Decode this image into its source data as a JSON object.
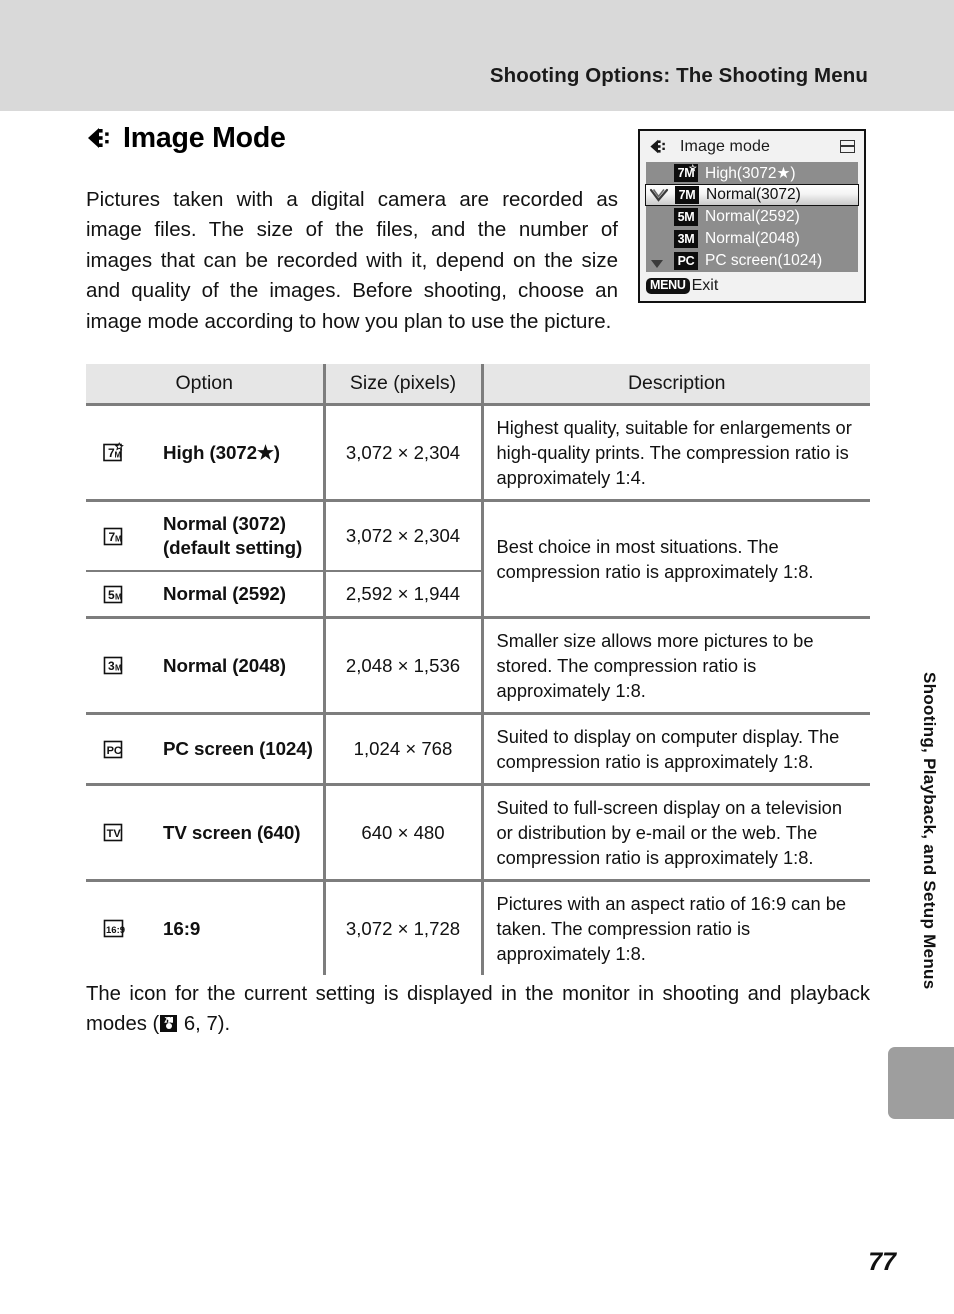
{
  "header": {
    "running_title": "Shooting Options: The Shooting Menu"
  },
  "section": {
    "icon": "image-mode-icon",
    "title": "Image Mode",
    "intro": "Pictures taken with a digital camera are recorded as image files. The size of the files, and the number of images that can be recorded with it, depend on the size and quality of the images. Before shooting, choose an image mode according to how you plan to use the picture."
  },
  "camera_screen": {
    "title": "Image mode",
    "title_icon": "image-mode-icon",
    "card_icon": "memory-card-icon",
    "items": [
      {
        "badge": "7",
        "badge_unit": "M",
        "badge_star": "☆",
        "label": "High(3072★)",
        "selected": false,
        "checked": false
      },
      {
        "badge": "7",
        "badge_unit": "M",
        "badge_star": "",
        "label": "Normal(3072)",
        "selected": true,
        "checked": true
      },
      {
        "badge": "5",
        "badge_unit": "M",
        "badge_star": "",
        "label": "Normal(2592)",
        "selected": false,
        "checked": false
      },
      {
        "badge": "3",
        "badge_unit": "M",
        "badge_star": "",
        "label": "Normal(2048)",
        "selected": false,
        "checked": false
      },
      {
        "badge": "PC",
        "badge_unit": "",
        "badge_star": "",
        "label": "PC screen(1024)",
        "selected": false,
        "checked": false
      }
    ],
    "menu_badge": "MENU",
    "exit_label": "Exit"
  },
  "table": {
    "headers": [
      "Option",
      "Size (pixels)",
      "Description"
    ],
    "rows": [
      {
        "icon": "7m-star-icon",
        "option": "High (3072★)",
        "size": "3,072 × 2,304",
        "description": "Highest quality, suitable for enlargements or high-quality prints. The compression ratio is approximately 1:4."
      },
      {
        "icon": "7m-icon",
        "option": "Normal (3072)\n(default setting)",
        "size": "3,072 × 2,304",
        "description": "Best choice in most situations. The compression ratio is approximately 1:8."
      },
      {
        "icon": "5m-icon",
        "option": "Normal (2592)",
        "size": "2,592 × 1,944",
        "description": ""
      },
      {
        "icon": "3m-icon",
        "option": "Normal (2048)",
        "size": "2,048 × 1,536",
        "description": "Smaller size allows more pictures to be stored. The compression ratio is approximately 1:8."
      },
      {
        "icon": "pc-icon",
        "option": "PC screen (1024)",
        "size": "1,024 × 768",
        "description": "Suited to display on computer display. The compression ratio is approximately 1:8."
      },
      {
        "icon": "tv-icon",
        "option": "TV screen (640)",
        "size": "640 × 480",
        "description": "Suited to full-screen display on a television or distribution by e-mail or the web. The compression ratio is approximately 1:8."
      },
      {
        "icon": "16-9-icon",
        "option": "16:9",
        "size": "3,072 × 1,728",
        "description": "Pictures with an aspect ratio of 16:9 can be taken. The compression ratio is approximately 1:8."
      }
    ]
  },
  "closing": {
    "text_before": "The icon for the current setting is displayed in the monitor in shooting and playback modes (",
    "reference_icon": "reference-book-icon",
    "text_after": " 6, 7)."
  },
  "side_tab": {
    "label": "Shooting, Playback, and Setup Menus"
  },
  "page_number": "77",
  "colors": {
    "header_band": "#d9d9d9",
    "table_rule": "#7d7d7d",
    "table_header_fill": "#e6e6e6",
    "camera_list_bg": "#8d8d8d",
    "side_tab": "#9e9e9e"
  }
}
